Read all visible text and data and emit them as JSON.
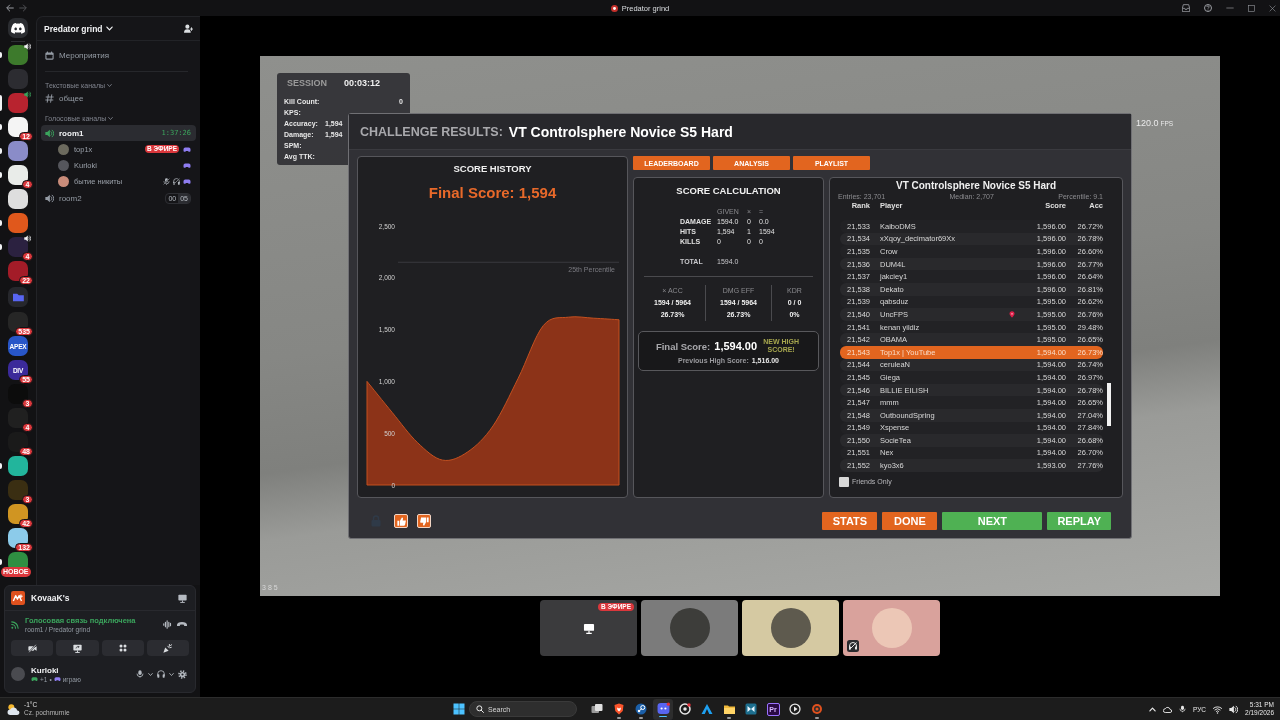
{
  "titlebar": {
    "title": "Predator grind"
  },
  "servers": [
    {
      "kind": "home",
      "unread": false,
      "selected": false,
      "voice": false
    },
    {
      "kind": "guild",
      "color": "#3d7a2c",
      "unread": true,
      "selected": false,
      "voice": true
    },
    {
      "kind": "guild",
      "color": "#2c2c31",
      "unread": false,
      "selected": false,
      "voice": false
    },
    {
      "kind": "guild",
      "color": "#b8232f",
      "unread": false,
      "selected": true,
      "voice": true
    },
    {
      "kind": "guild",
      "color": "#f4f4f4",
      "badge": "12",
      "unread": true,
      "selected": false,
      "voice": false
    },
    {
      "kind": "guild",
      "color": "#8a8cc8",
      "unread": true,
      "selected": false,
      "voice": false
    },
    {
      "kind": "guild",
      "color": "#e9ece9",
      "badge": "4",
      "unread": true,
      "selected": false,
      "voice": false
    },
    {
      "kind": "guild",
      "color": "#dedede",
      "unread": false,
      "selected": false,
      "voice": false
    },
    {
      "kind": "guild",
      "color": "#e0581c",
      "unread": true,
      "selected": false,
      "voice": false
    },
    {
      "kind": "guild",
      "color": "#2b2140",
      "badge": "4",
      "unread": true,
      "selected": false,
      "voice": true
    },
    {
      "kind": "guild",
      "color": "#a31c28",
      "badge": "22",
      "unread": false,
      "selected": false,
      "voice": false
    },
    {
      "kind": "folder",
      "unread": false,
      "selected": false,
      "voice": false
    },
    {
      "kind": "guild",
      "color": "#262626",
      "badge": "535",
      "unread": false,
      "selected": false,
      "voice": false
    },
    {
      "kind": "guild",
      "color": "#2856c8",
      "glyph": "APEX",
      "unread": false,
      "selected": false,
      "voice": false
    },
    {
      "kind": "guild",
      "color": "#3b2a9a",
      "glyph": "DIV",
      "badge": "55",
      "unread": false,
      "selected": false,
      "voice": false
    },
    {
      "kind": "guild",
      "color": "#0c0c0c",
      "badge": "3",
      "unread": false,
      "selected": false,
      "voice": false
    },
    {
      "kind": "guild",
      "color": "#202020",
      "badge": "4",
      "unread": false,
      "selected": false,
      "voice": false
    },
    {
      "kind": "guild",
      "color": "#1a1a1a",
      "badge": "48",
      "unread": false,
      "selected": false,
      "voice": false
    },
    {
      "kind": "guild",
      "color": "#22b59c",
      "unread": true,
      "selected": false,
      "voice": false
    },
    {
      "kind": "guild",
      "color": "#3a2e12",
      "badge": "3",
      "unread": false,
      "selected": false,
      "voice": false
    },
    {
      "kind": "guild",
      "color": "#d09522",
      "badge": "42",
      "unread": false,
      "selected": false,
      "voice": false
    },
    {
      "kind": "guild",
      "color": "#8ccbea",
      "badge": "132",
      "unread": false,
      "selected": false,
      "voice": false
    },
    {
      "kind": "guild",
      "color": "#2f8f42",
      "unread": true,
      "selected": false,
      "voice": false
    }
  ],
  "new_badge": "НОВОЕ",
  "guild": {
    "name": "Predator grind",
    "events": "Мероприятия"
  },
  "categories": [
    {
      "name": "Текстовые каналы",
      "expanded": true,
      "channels": [
        {
          "kind": "text",
          "name": "общее",
          "selected": false
        }
      ]
    },
    {
      "name": "Голосовые каналы",
      "expanded": true,
      "channels": [
        {
          "kind": "voice",
          "name": "room1",
          "selected": true,
          "duration": "1:37:26",
          "members": [
            {
              "name": "top1x",
              "live": "В ЭФИРЕ",
              "muted": false,
              "deafened": false,
              "activity": true
            },
            {
              "name": "Kurloki",
              "muted": false,
              "deafened": false,
              "activity": true
            },
            {
              "name": "бытие никиты",
              "muted": true,
              "deafened": true,
              "activity": true
            }
          ]
        },
        {
          "kind": "voice",
          "name": "room2",
          "selected": false,
          "user_count": "00",
          "user_limit": "05"
        }
      ]
    }
  ],
  "activity": {
    "app": "KovaaK's"
  },
  "voice": {
    "status": "Голосовая связь подключена",
    "location": "room1 / Predator grind"
  },
  "user": {
    "name": "Kurloki",
    "status_count": "+1",
    "separator": "•",
    "status_text": "играю"
  },
  "stream": {
    "session": {
      "title": "SESSION",
      "time": "00:03:12",
      "stats": [
        {
          "kind": "count",
          "label": "Kill Count:",
          "value": "0"
        },
        {
          "kind": "rate",
          "label": "KPS:"
        },
        {
          "kind": "ratio",
          "label": "Accuracy:",
          "value": "1,594"
        },
        {
          "kind": "ratio",
          "label": "Damage:",
          "value": "1,594"
        },
        {
          "kind": "rate",
          "label": "SPM:"
        },
        {
          "kind": "rate",
          "label": "Avg TTK:"
        }
      ]
    },
    "fps": {
      "value": "120.0",
      "unit": "FPS"
    },
    "corner_text": "385",
    "dialog": {
      "heading": "CHALLENGE RESULTS:",
      "scenario": "VT Controlsphere Novice S5 Hard",
      "history": {
        "title": "SCORE HISTORY",
        "final": "Final Score: 1,594",
        "axis_labels": [
          "2,500",
          "2,000",
          "1,500",
          "1,000",
          "500",
          "0"
        ],
        "reference_label": "25th Percentile"
      },
      "tabs": [
        {
          "label": "LEADERBOARD"
        },
        {
          "label": "ANALYSIS"
        },
        {
          "label": "PLAYLIST"
        }
      ],
      "calculation": {
        "title": "SCORE CALCULATION",
        "columns": [
          "GIVEN",
          "×",
          "="
        ],
        "rows": [
          {
            "label": "DAMAGE",
            "cells": [
              "1594.0",
              "0",
              "0.0"
            ]
          },
          {
            "label": "HITS",
            "cells": [
              "1,594",
              "1",
              "1594"
            ]
          },
          {
            "label": "KILLS",
            "cells": [
              "0",
              "0",
              "0"
            ]
          }
        ],
        "total": {
          "label": "TOTAL",
          "value": "1594.0"
        },
        "stats": [
          {
            "label": "× ACC",
            "ratio": "1594 / 5964",
            "percent": "26.73%"
          },
          {
            "label": "DMG EFF",
            "ratio": "1594 / 5964",
            "percent": "26.73%"
          },
          {
            "label": "KDR",
            "ratio": "0 / 0",
            "percent": "0%"
          }
        ],
        "final": {
          "label": "Final Score:",
          "value": "1,594.00",
          "note": "NEW HIGH SCORE!",
          "previous_label": "Previous High Score:",
          "previous_value": "1,516.00"
        }
      },
      "leaderboard": {
        "title": "VT Controlsphere Novice S5 Hard",
        "entries": "Entries: 23,701",
        "median": "Median: 2,707",
        "percentile": "Percentile: 9.1",
        "columns": [
          "Rank",
          "Player",
          "Score",
          "Acc"
        ],
        "rows": [
          {
            "rank": "21,533",
            "player": "KaiboDMS",
            "score": "1,596.00",
            "acc": "26.72%",
            "selected": false,
            "marker": false
          },
          {
            "rank": "21,534",
            "player": "xXqoy_decimator69Xx",
            "score": "1,596.00",
            "acc": "26.78%",
            "selected": false,
            "marker": false
          },
          {
            "rank": "21,535",
            "player": "Crow",
            "score": "1,596.00",
            "acc": "26.60%",
            "selected": false,
            "marker": false
          },
          {
            "rank": "21,536",
            "player": "DUM4L",
            "score": "1,596.00",
            "acc": "26.77%",
            "selected": false,
            "marker": false
          },
          {
            "rank": "21,537",
            "player": "jakciey1",
            "score": "1,596.00",
            "acc": "26.64%",
            "selected": false,
            "marker": false
          },
          {
            "rank": "21,538",
            "player": "Dekato",
            "score": "1,596.00",
            "acc": "26.81%",
            "selected": false,
            "marker": false
          },
          {
            "rank": "21,539",
            "player": "qabsduz",
            "score": "1,595.00",
            "acc": "26.62%",
            "selected": false,
            "marker": false
          },
          {
            "rank": "21,540",
            "player": "UncFPS",
            "score": "1,595.00",
            "acc": "26.76%",
            "selected": false,
            "marker": true
          },
          {
            "rank": "21,541",
            "player": "kenan yildiz",
            "score": "1,595.00",
            "acc": "29.48%",
            "selected": false,
            "marker": false
          },
          {
            "rank": "21,542",
            "player": "OBAMA",
            "score": "1,595.00",
            "acc": "26.65%",
            "selected": false,
            "marker": false
          },
          {
            "rank": "21,543",
            "player": "Top1x | YouTube",
            "score": "1,594.00",
            "acc": "26.73%",
            "selected": true,
            "marker": false
          },
          {
            "rank": "21,544",
            "player": "ceruleaN",
            "score": "1,594.00",
            "acc": "26.74%",
            "selected": false,
            "marker": false
          },
          {
            "rank": "21,545",
            "player": "Giega",
            "score": "1,594.00",
            "acc": "26.97%",
            "selected": false,
            "marker": false
          },
          {
            "rank": "21,546",
            "player": "BILLIE EILISH",
            "score": "1,594.00",
            "acc": "26.78%",
            "selected": false,
            "marker": false
          },
          {
            "rank": "21,547",
            "player": "mmm",
            "score": "1,594.00",
            "acc": "26.65%",
            "selected": false,
            "marker": false
          },
          {
            "rank": "21,548",
            "player": "OutboundSpring",
            "score": "1,594.00",
            "acc": "27.04%",
            "selected": false,
            "marker": false
          },
          {
            "rank": "21,549",
            "player": "Xspense",
            "score": "1,594.00",
            "acc": "27.84%",
            "selected": false,
            "marker": false
          },
          {
            "rank": "21,550",
            "player": "SocieTea",
            "score": "1,594.00",
            "acc": "26.68%",
            "selected": false,
            "marker": false
          },
          {
            "rank": "21,551",
            "player": "Nex",
            "score": "1,594.00",
            "acc": "26.70%",
            "selected": false,
            "marker": false
          },
          {
            "rank": "21,552",
            "player": "kyo3x6",
            "score": "1,593.00",
            "acc": "27.76%",
            "selected": false,
            "marker": false
          }
        ],
        "friends_only": {
          "label": "Friends Only",
          "checked": false
        }
      },
      "buttons": [
        {
          "label": "STATS",
          "kind": "secondary",
          "wide": false
        },
        {
          "label": "DONE",
          "kind": "secondary",
          "wide": false
        },
        {
          "label": "NEXT",
          "kind": "primary",
          "wide": true
        },
        {
          "label": "REPLAY",
          "kind": "primary",
          "wide": false
        }
      ]
    }
  },
  "tiles": [
    {
      "kind": "stream",
      "live": "В ЭФИРЕ",
      "color": "#3b3b3d",
      "deafened": false
    },
    {
      "kind": "camera",
      "color": "#7b7b7b",
      "deafened": false
    },
    {
      "kind": "camera",
      "color": "#d5c9a2",
      "deafened": false
    },
    {
      "kind": "camera",
      "color": "#d9a29c",
      "deafened": true
    }
  ],
  "taskbar": {
    "weather": {
      "temp": "-1°C",
      "desc": "Cz. pochmurnie"
    },
    "search": {
      "placeholder": "Search"
    },
    "apps": [
      {
        "kind": "taskview",
        "running": false,
        "active": false
      },
      {
        "kind": "shield",
        "running": true,
        "active": false
      },
      {
        "kind": "steam",
        "running": true,
        "active": false
      },
      {
        "kind": "chat",
        "running": true,
        "active": true
      },
      {
        "kind": "aperture",
        "running": false,
        "active": false
      },
      {
        "kind": "triangle",
        "running": false,
        "active": false
      },
      {
        "kind": "folder",
        "running": true,
        "active": false
      },
      {
        "kind": "bowtie",
        "running": false,
        "active": false
      },
      {
        "kind": "text",
        "glyph": "Pr",
        "running": false,
        "active": false
      },
      {
        "kind": "play",
        "running": false,
        "active": false
      },
      {
        "kind": "target",
        "running": true,
        "active": false
      }
    ],
    "tray": {
      "language": "РУС",
      "time": "5:31 PM",
      "date": "2/19/2026"
    }
  }
}
